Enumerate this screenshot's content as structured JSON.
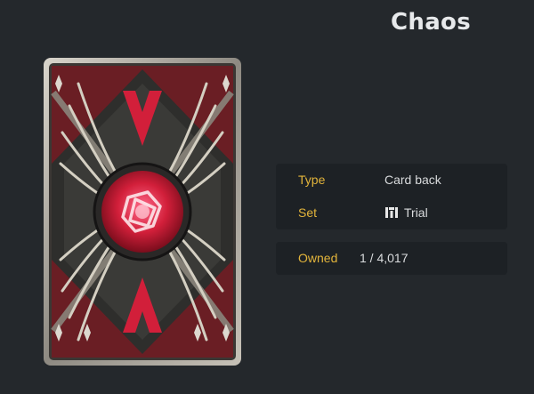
{
  "item": {
    "title": "Chaos"
  },
  "card_image": {
    "icon": "chaos-card-back-art",
    "accent": "#d21f3a"
  },
  "details": {
    "type_label": "Type",
    "type_value": "Card back",
    "set_label": "Set",
    "set_icon": "trial-set-icon",
    "set_value": "Trial"
  },
  "ownership": {
    "owned_label": "Owned",
    "owned_value": "1 / 4,017"
  },
  "colors": {
    "background": "#24282c",
    "panel": "#1d2125",
    "label": "#e2b43b"
  }
}
